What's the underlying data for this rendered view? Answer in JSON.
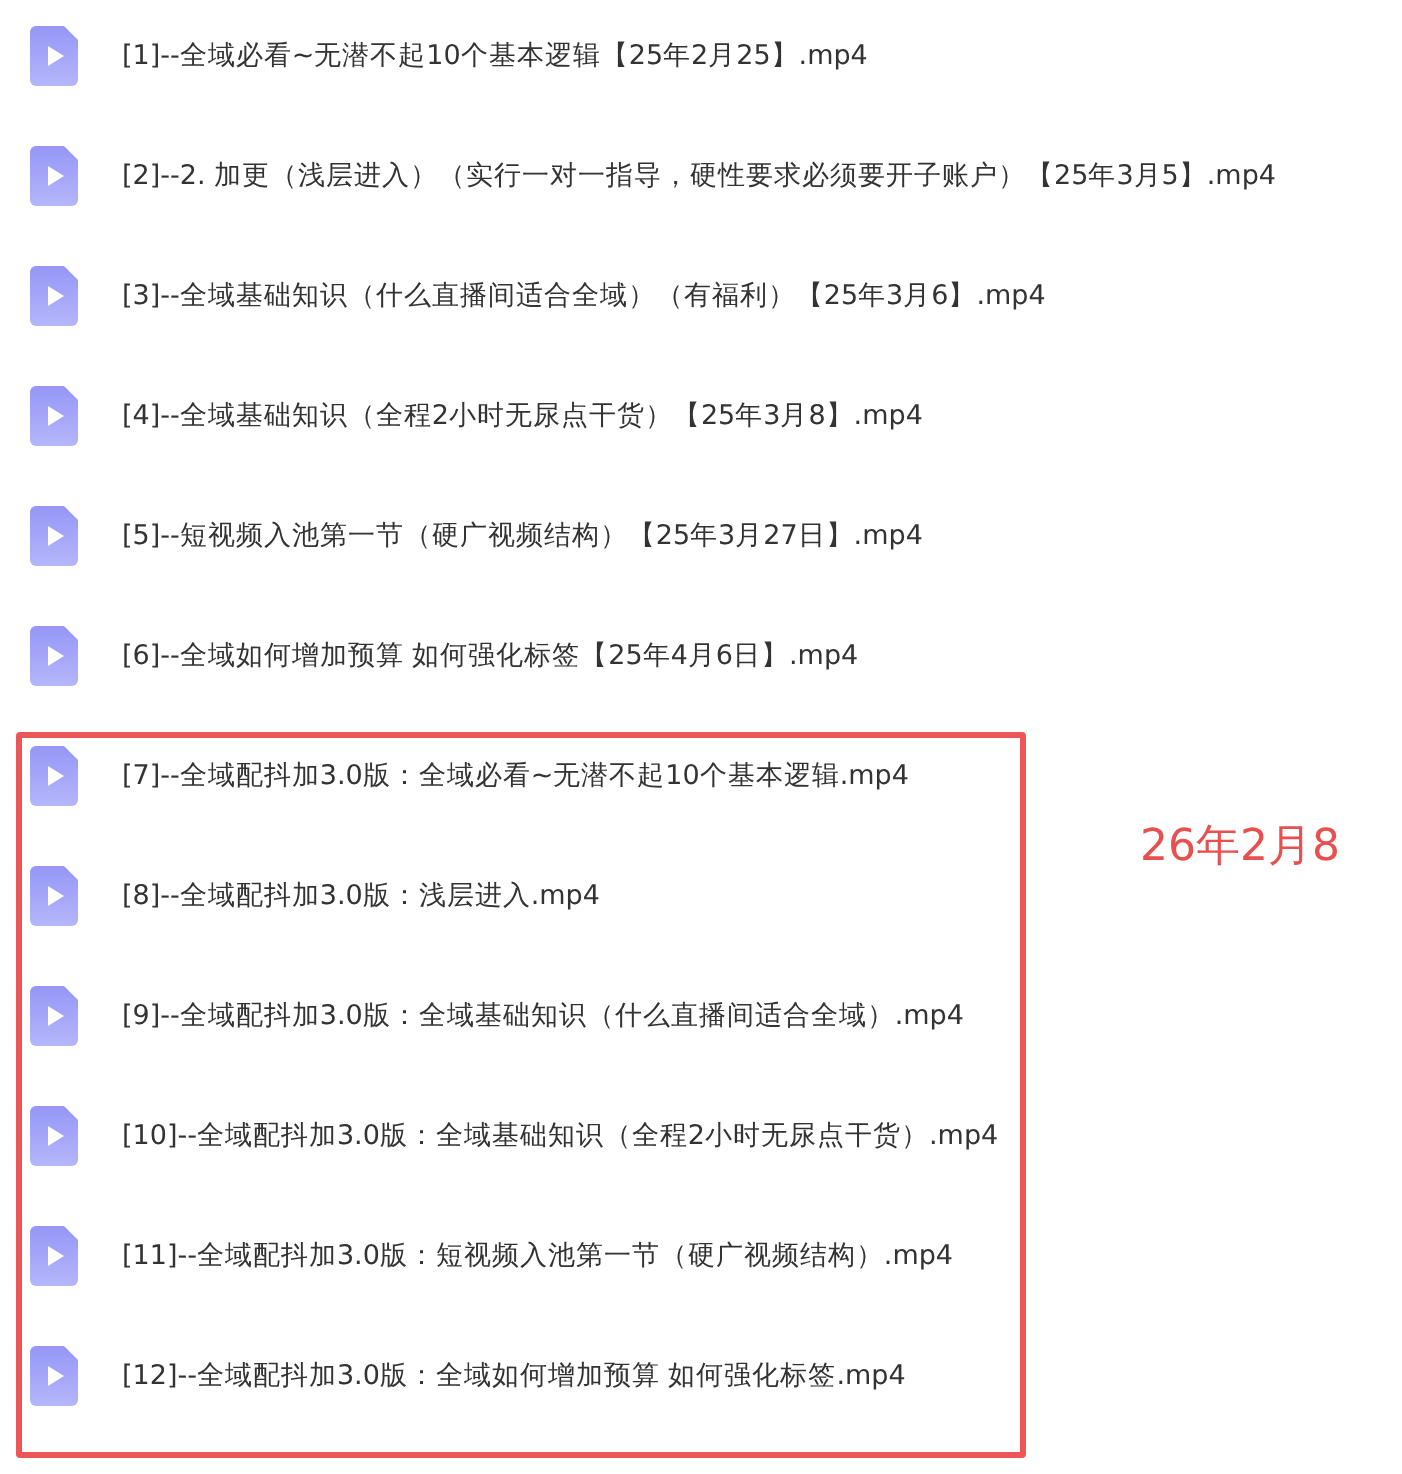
{
  "files": [
    {
      "name": "[1]--全域必看~无潜不起10个基本逻辑【25年2月25】.mp4"
    },
    {
      "name": "[2]--2. 加更（浅层进入）（实行一对一指导，硬性要求必须要开子账户）【25年3月5】.mp4"
    },
    {
      "name": "[3]--全域基础知识（什么直播间适合全域）（有福利）【25年3月6】.mp4"
    },
    {
      "name": "[4]--全域基础知识（全程2小时无尿点干货）【25年3月8】.mp4"
    },
    {
      "name": "[5]--短视频入池第一节（硬广视频结构）【25年3月27日】.mp4"
    },
    {
      "name": "[6]--全域如何增加预算 如何强化标签【25年4月6日】.mp4"
    }
  ],
  "highlighted_group": {
    "note": "26年2月8",
    "files": [
      {
        "name": "[7]--全域配抖加3.0版：全域必看~无潜不起10个基本逻辑.mp4"
      },
      {
        "name": "[8]--全域配抖加3.0版：浅层进入.mp4"
      },
      {
        "name": "[9]--全域配抖加3.0版：全域基础知识（什么直播间适合全域）.mp4"
      },
      {
        "name": "[10]--全域配抖加3.0版：全域基础知识（全程2小时无尿点干货）.mp4"
      },
      {
        "name": "[11]--全域配抖加3.0版：短视频入池第一节（硬广视频结构）.mp4"
      },
      {
        "name": "[12]--全域配抖加3.0版：全域如何增加预算 如何强化标签.mp4"
      }
    ]
  }
}
